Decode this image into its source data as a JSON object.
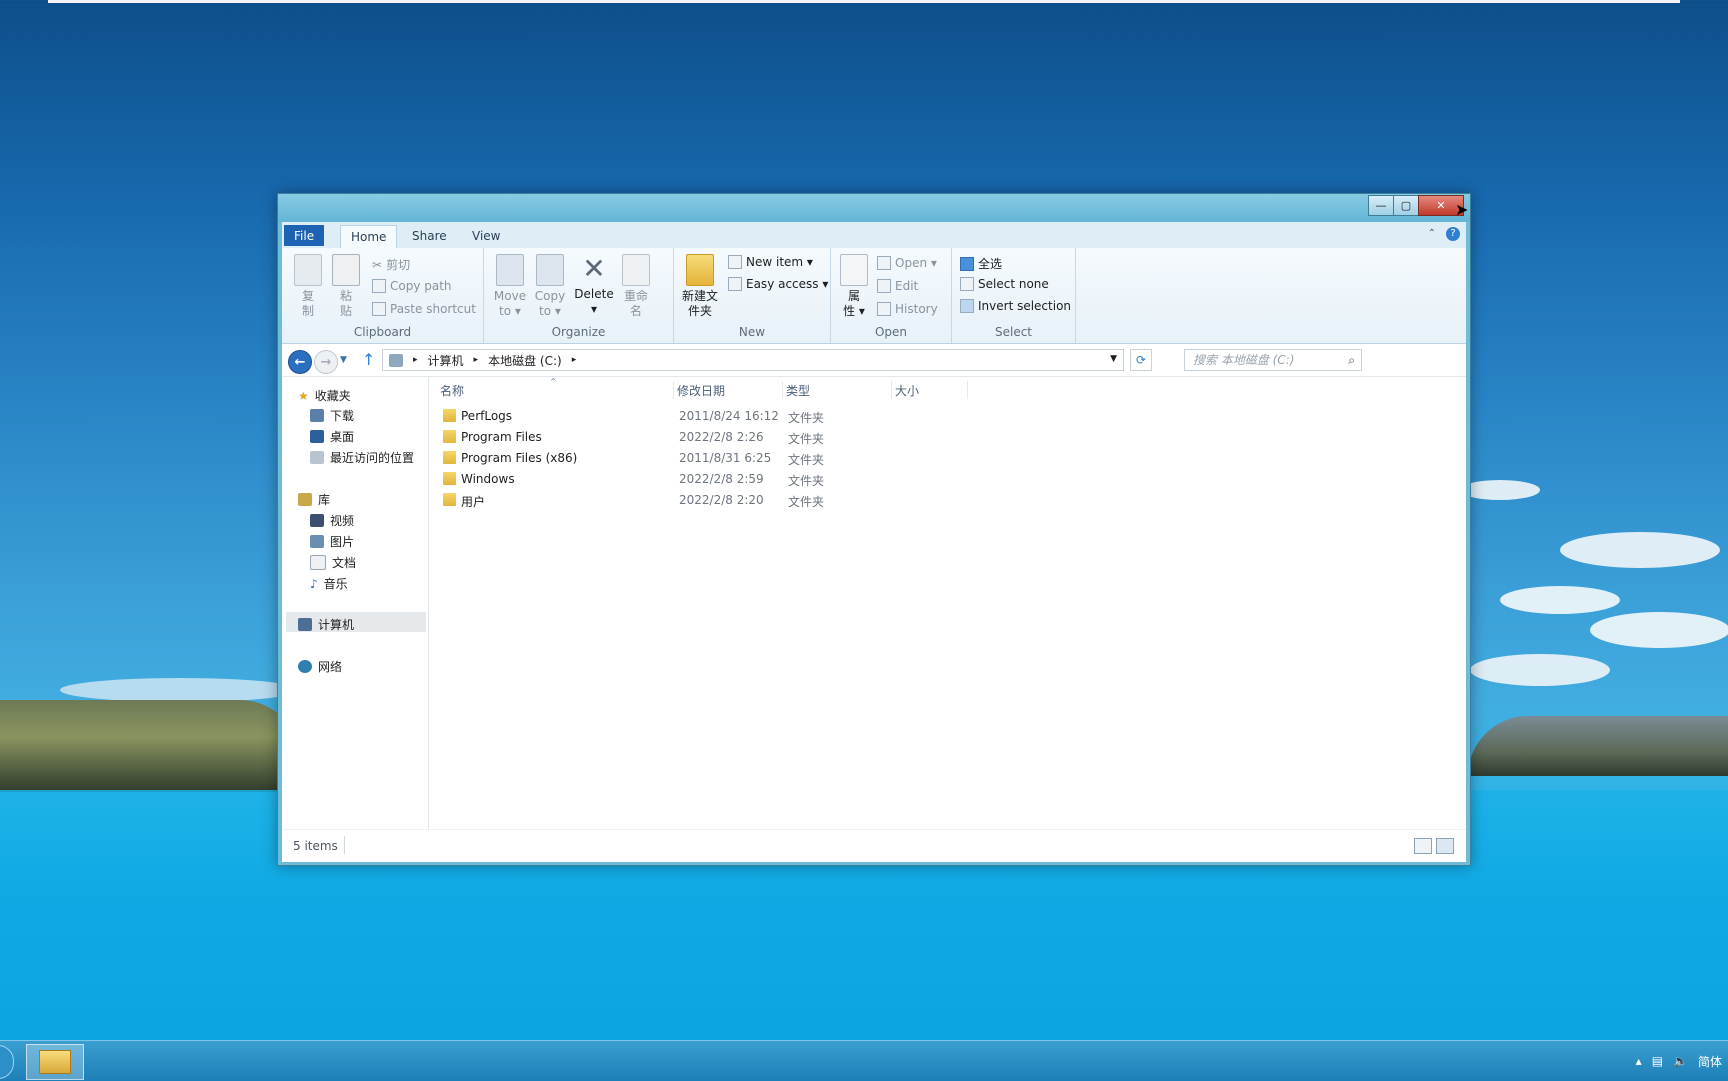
{
  "window": {
    "controls": {
      "minimize": "—",
      "maximize": "▢",
      "close": "✕"
    },
    "tabs": {
      "file": "File",
      "home": "Home",
      "share": "Share",
      "view": "View"
    },
    "ribbon": {
      "clipboard": {
        "copy": "复\n制",
        "paste": "粘\n贴",
        "cut": "剪切",
        "copy_path": "Copy path",
        "paste_shortcut": "Paste shortcut",
        "label": "Clipboard"
      },
      "organize": {
        "move_to": "Move\nto ▾",
        "copy_to": "Copy\nto ▾",
        "delete": "Delete\n▾",
        "rename": "重命\n名",
        "label": "Organize"
      },
      "new": {
        "new_folder": "新建文\n件夹",
        "new_item": "New item ▾",
        "easy_access": "Easy access ▾",
        "label": "New"
      },
      "open": {
        "properties": "属\n性 ▾",
        "open": "Open ▾",
        "edit": "Edit",
        "history": "History",
        "label": "Open"
      },
      "select": {
        "select_all": "全选",
        "select_none": "Select none",
        "invert": "Invert selection",
        "label": "Select"
      }
    },
    "address": {
      "crumb1": "计算机",
      "crumb2": "本地磁盘 (C:)",
      "search_placeholder": "搜索 本地磁盘 (C:)"
    },
    "nav": {
      "favorites": "收藏夹",
      "downloads": "下载",
      "desktop": "桌面",
      "recent": "最近访问的位置",
      "libraries": "库",
      "videos": "视频",
      "pictures": "图片",
      "documents": "文档",
      "music": "音乐",
      "computer": "计算机",
      "network": "网络"
    },
    "columns": {
      "name": "名称",
      "modified": "修改日期",
      "type": "类型",
      "size": "大小"
    },
    "files": [
      {
        "name": "PerfLogs",
        "modified": "2011/8/24 16:12",
        "type": "文件夹"
      },
      {
        "name": "Program Files",
        "modified": "2022/2/8 2:26",
        "type": "文件夹"
      },
      {
        "name": "Program Files (x86)",
        "modified": "2011/8/31 6:25",
        "type": "文件夹"
      },
      {
        "name": "Windows",
        "modified": "2022/2/8 2:59",
        "type": "文件夹"
      },
      {
        "name": "用户",
        "modified": "2022/2/8 2:20",
        "type": "文件夹"
      }
    ],
    "status": {
      "count": "5 items"
    }
  },
  "taskbar": {
    "lang": "简体"
  }
}
